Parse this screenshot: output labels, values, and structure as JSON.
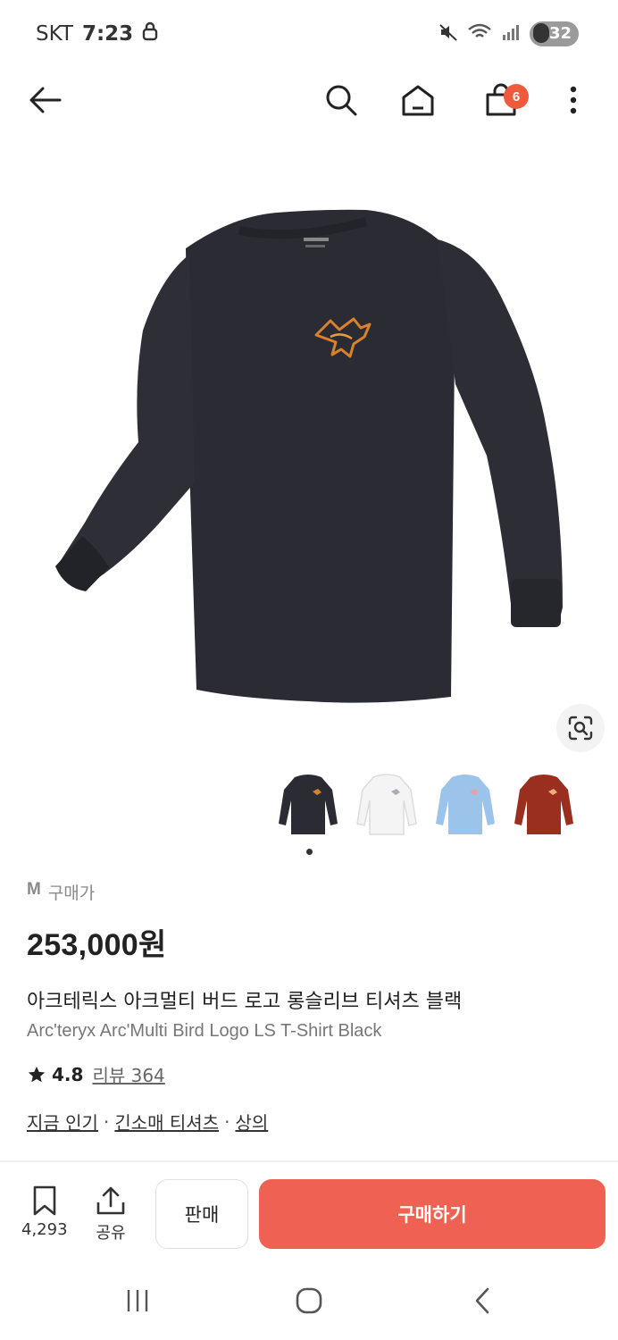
{
  "status": {
    "carrier": "SKT",
    "time": "7:23",
    "battery": "32"
  },
  "nav": {
    "cart_count": "6"
  },
  "gallery": {
    "thumbnails": [
      {
        "name": "black",
        "color": "#2b2c33"
      },
      {
        "name": "white",
        "color": "#f4f4f4"
      },
      {
        "name": "light-blue",
        "color": "#9cc3ea"
      },
      {
        "name": "red",
        "color": "#9b2f1f"
      }
    ],
    "hero_color": "#2b2c33",
    "logo_color": "#d9822b"
  },
  "product": {
    "size": "M",
    "price_label": "구매가",
    "price": "253,000원",
    "title_ko": "아크테릭스 아크멀티 버드 로고 롱슬리브 티셔츠 블랙",
    "title_en": "Arc'teryx Arc'Multi Bird Logo LS T-Shirt Black",
    "rating": "4.8",
    "review_label": "리뷰 364",
    "categories": [
      {
        "label": "지금 인기"
      },
      {
        "label": "긴소매 티셔츠"
      },
      {
        "label": "상의"
      }
    ]
  },
  "bottom": {
    "save_count": "4,293",
    "share_label": "공유",
    "sell_label": "판매",
    "buy_label": "구매하기",
    "accent": "#ef6253"
  }
}
